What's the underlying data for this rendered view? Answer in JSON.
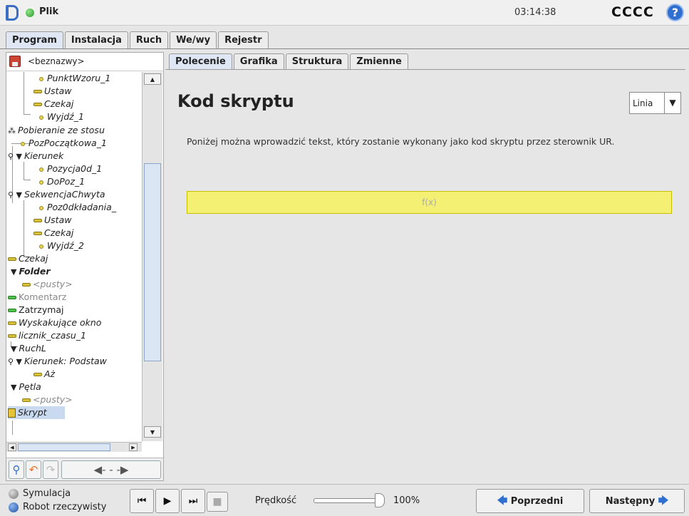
{
  "header": {
    "file_menu": "Plik",
    "time": "03:14:38",
    "robot_name": "CCCC",
    "help": "?"
  },
  "main_tabs": [
    "Program",
    "Instalacja",
    "Ruch",
    "We/wy",
    "Rejestr"
  ],
  "program": {
    "name": "<beznazwy>"
  },
  "tree": [
    {
      "label": "PunktWzoru_1"
    },
    {
      "label": "Ustaw"
    },
    {
      "label": "Czekaj"
    },
    {
      "label": "Wyjdź_1"
    },
    {
      "label": "Pobieranie ze stosu"
    },
    {
      "label": "PozPoczątkowa_1"
    },
    {
      "label": "Kierunek"
    },
    {
      "label": "Pozycja0d_1"
    },
    {
      "label": "DoPoz_1"
    },
    {
      "label": "SekwencjaChwyta"
    },
    {
      "label": "Poz0dkładania_"
    },
    {
      "label": "Ustaw"
    },
    {
      "label": "Czekaj"
    },
    {
      "label": "Wyjdź_2"
    },
    {
      "label": "Czekaj"
    },
    {
      "label": "Folder"
    },
    {
      "label": "<pusty>"
    },
    {
      "label": "Komentarz"
    },
    {
      "label": "Zatrzymaj"
    },
    {
      "label": "Wyskakujące okno"
    },
    {
      "label": "licznik_czasu_1"
    },
    {
      "label": "RuchL"
    },
    {
      "label": "Kierunek: Podstaw"
    },
    {
      "label": "Aż"
    },
    {
      "label": "Pętla"
    },
    {
      "label": "<pusty>"
    },
    {
      "label": "Skrypt"
    }
  ],
  "right_tabs": [
    "Polecenie",
    "Grafika",
    "Struktura",
    "Zmienne"
  ],
  "content": {
    "title": "Kod skryptu",
    "mode_value": "Linia",
    "description": "Poniżej można wprowadzić tekst, który zostanie wykonany jako kod skryptu przez sterownik UR.",
    "script_placeholder": "f(x)"
  },
  "footer": {
    "simulation": "Symulacja",
    "real_robot": "Robot rzeczywisty",
    "speed_label": "Prędkość",
    "speed_value": "100%",
    "speed_fraction": 1.0,
    "prev": "Poprzedni",
    "next": "Następny"
  },
  "colors": {
    "accent": "#2f6fd0",
    "script_field": "#f4f073",
    "status_ok": "#2a9a25"
  }
}
